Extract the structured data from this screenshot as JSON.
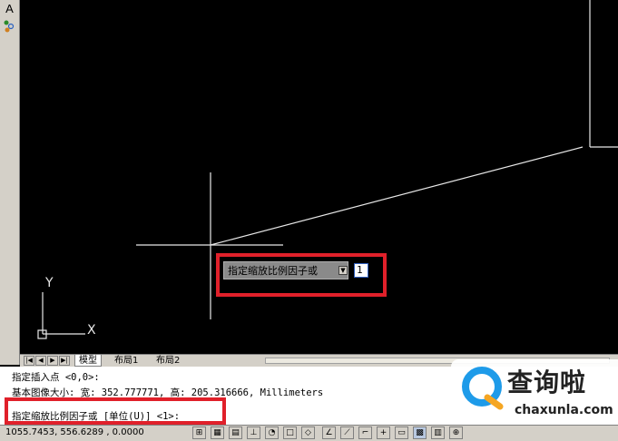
{
  "left_toolbar": {
    "top_tool_glyph": "A",
    "second_tool_icon": "snap-points-icon"
  },
  "drawing": {
    "dynamic_input": {
      "prompt": "指定缩放比例因子或",
      "value": "1",
      "arrow_icon": "dropdown-arrow-icon"
    },
    "ucs_icon": {
      "y_label": "Y",
      "x_label": "X"
    }
  },
  "tabs": {
    "nav_buttons": [
      "|◀",
      "◀",
      "▶",
      "▶|"
    ],
    "items": [
      {
        "label": "模型",
        "active": true
      },
      {
        "label": "布局1",
        "active": false
      },
      {
        "label": "布局2",
        "active": false
      }
    ]
  },
  "command": {
    "line1": "指定插入点 <0,0>:",
    "line2": "基本图像大小: 宽: 352.777771, 高: 205.316666, Millimeters",
    "prompt": "指定缩放比例因子或 [单位(U)] <1>:"
  },
  "status": {
    "coordinates": "1055.7453, 556.6289 , 0.0000"
  },
  "watermark": {
    "title": "查询啦",
    "url": "chaxunla.com"
  },
  "colors": {
    "highlight": "#e0202a",
    "canvas": "#000000",
    "watermark_accent": "#1e9be9"
  }
}
